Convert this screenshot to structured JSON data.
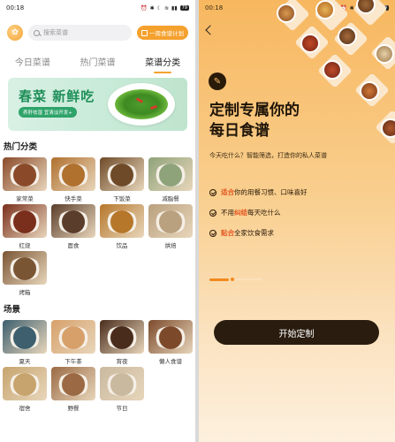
{
  "left": {
    "status_time": "00:18",
    "status_battery": "79",
    "search_placeholder": "搜索菜谱",
    "plan_button": "一周食谱计划",
    "tabs": [
      "今日菜谱",
      "热门菜谱",
      "菜谱分类"
    ],
    "banner": {
      "title": "春菜 新鲜吃",
      "subtitle": "养肝祛湿 宜清淡开发+"
    },
    "hot_title": "热门分类",
    "hot": [
      {
        "label": "家常菜",
        "color": "#8a4a2a"
      },
      {
        "label": "快手菜",
        "color": "#b0702e"
      },
      {
        "label": "下饭菜",
        "color": "#6e4a28"
      },
      {
        "label": "减脂餐",
        "color": "#8fa37a"
      },
      {
        "label": "红烧",
        "color": "#7a2f1c"
      },
      {
        "label": "面食",
        "color": "#5a3d2a"
      },
      {
        "label": "饮品",
        "color": "#b6772b"
      },
      {
        "label": "烘焙",
        "color": "#b9a07e"
      },
      {
        "label": "烤箱",
        "color": "#7a5534"
      }
    ],
    "scene_title": "场景",
    "scene": [
      {
        "label": "夏天",
        "color": "#3d5f6e"
      },
      {
        "label": "下午茶",
        "color": "#d7a06a"
      },
      {
        "label": "宵夜",
        "color": "#4a2c1c"
      },
      {
        "label": "懒人食谱",
        "color": "#7c4a2b"
      },
      {
        "label": "宿舍",
        "color": "#c7a46e"
      },
      {
        "label": "野餐",
        "color": "#9b6a44"
      },
      {
        "label": "节日",
        "color": "#c9b99e"
      }
    ]
  },
  "right": {
    "status_time": "00:18",
    "status_battery": "79",
    "title_line1": "定制专属你的",
    "title_line2": "每日食谱",
    "subtitle": "今天吃什么？智能筛选，打造你的私人菜谱",
    "features": [
      {
        "highlight": "适合",
        "rest": "你的用餐习惯、口味喜好"
      },
      {
        "highlight": "不用纠结",
        "rest": "每天吃什么",
        "prefix": "不用",
        "hl_mid": "纠结"
      },
      {
        "highlight": "贴合",
        "rest": "全家饮食需求"
      }
    ],
    "cta": "开始定制"
  }
}
